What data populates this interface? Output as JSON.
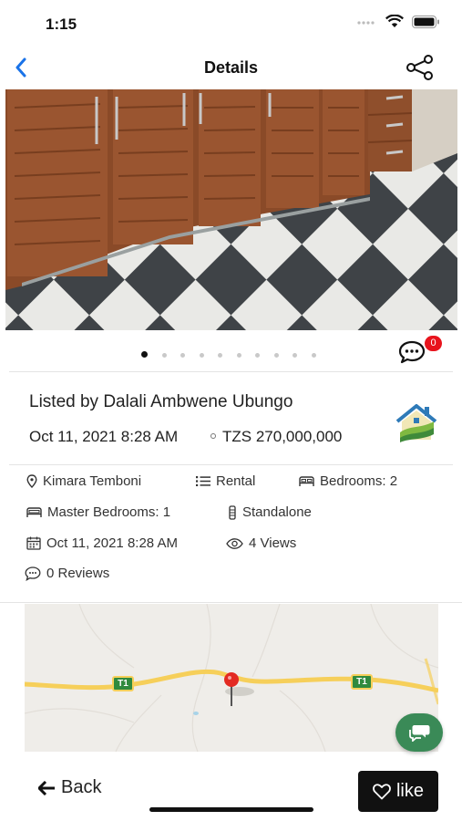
{
  "status_bar": {
    "time": "1:15"
  },
  "nav": {
    "title": "Details"
  },
  "gallery": {
    "slide_count": 10,
    "active_index": 0,
    "comment_count": "0"
  },
  "listing": {
    "listed_by": "Listed by Dalali Ambwene Ubungo",
    "date": "Oct 11, 2021 8:28 AM",
    "price": "TZS 270,000,000"
  },
  "attributes": {
    "location": "Kimara Temboni",
    "type": "Rental",
    "bedrooms": "Bedrooms: 2",
    "master_bedrooms": "Master Bedrooms: 1",
    "building": "Standalone",
    "posted": "Oct 11, 2021 8:28 AM",
    "views": "4 Views",
    "reviews": "0 Reviews"
  },
  "map": {
    "road_label_1": "T1",
    "road_label_2": "T1"
  },
  "footer": {
    "back_label": "Back",
    "like_label": "like"
  },
  "colors": {
    "accent_blue": "#1a73e8",
    "badge_red": "#e8141d",
    "fab_green": "#3a8a57",
    "road_yellow": "#f6cf5a"
  }
}
